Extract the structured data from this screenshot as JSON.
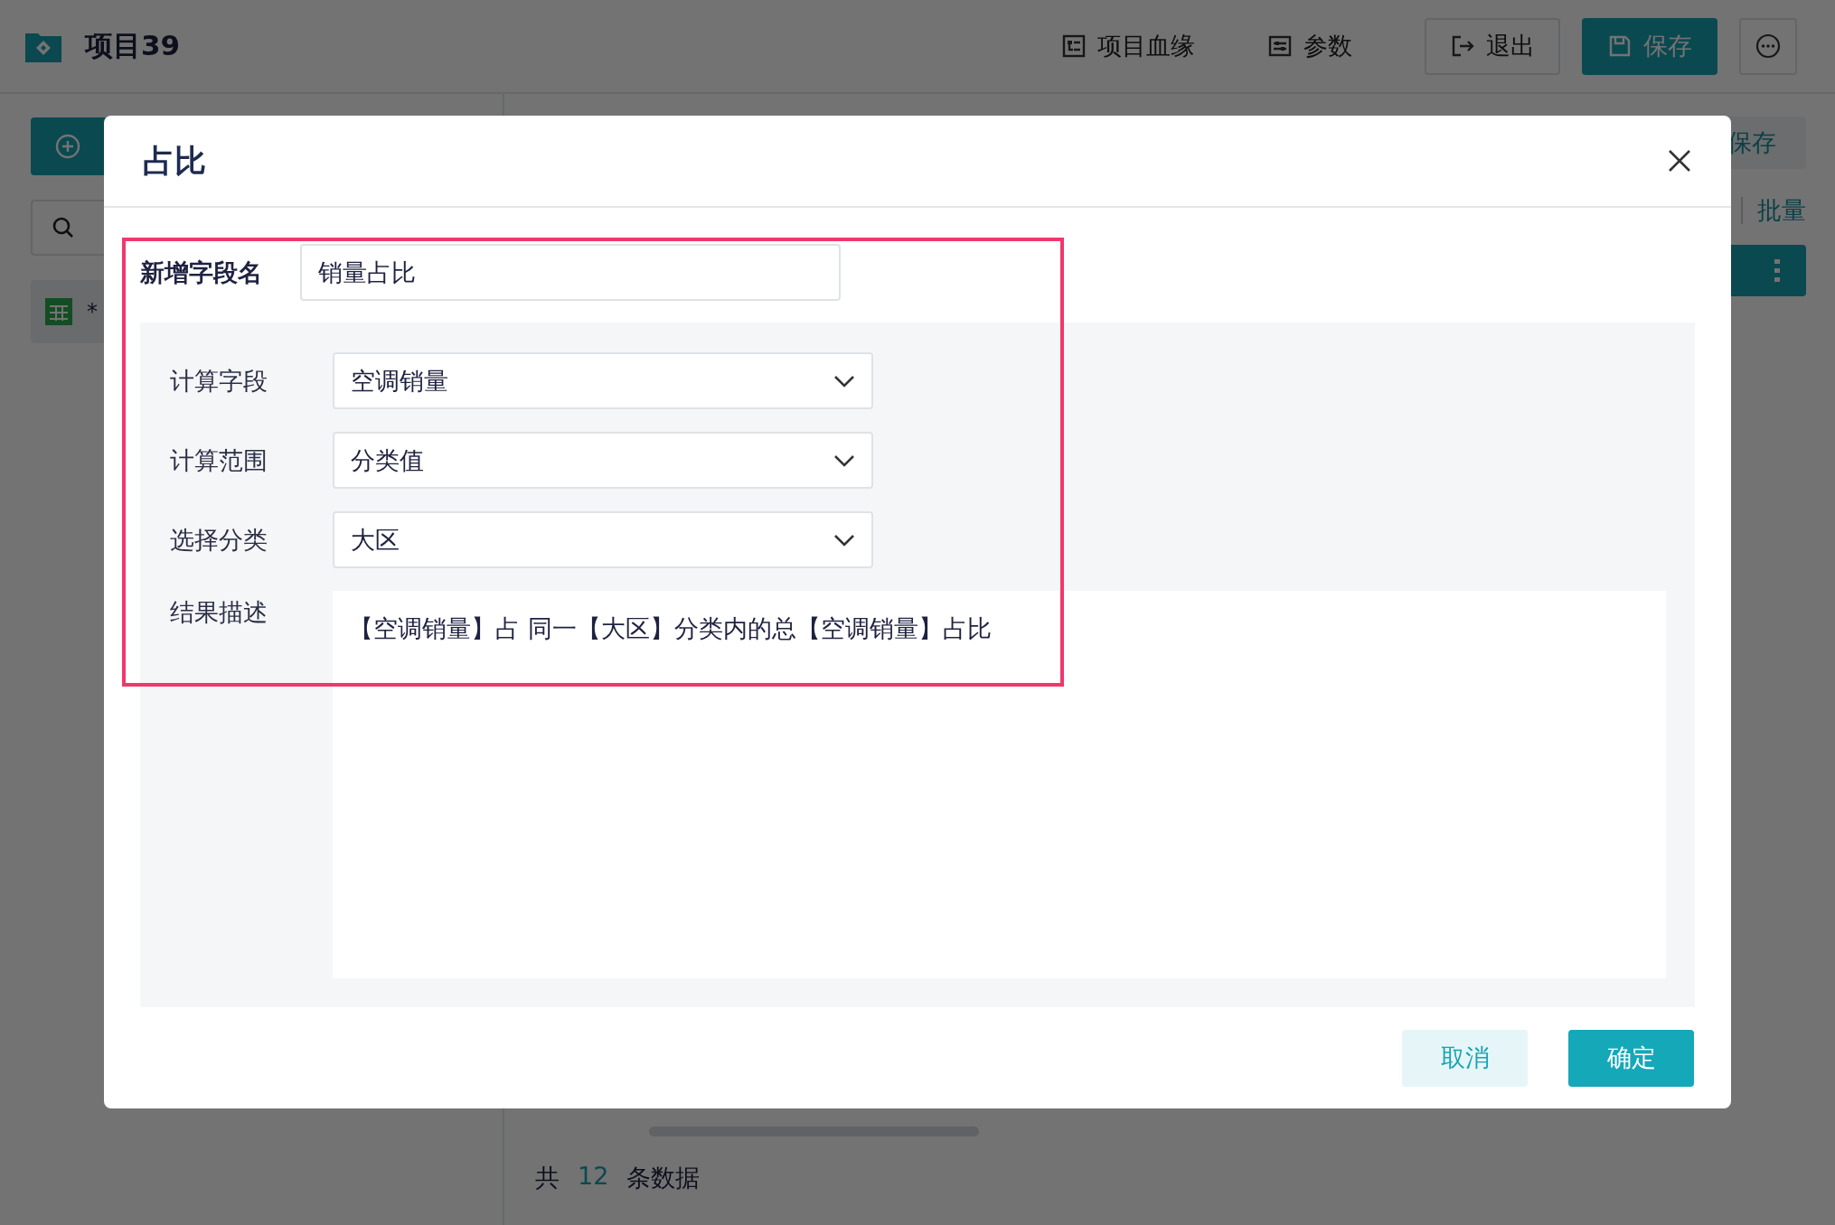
{
  "header": {
    "title": "项目39",
    "actions": [
      {
        "label": "项目血缘",
        "kind": "link"
      },
      {
        "label": "参数",
        "kind": "link"
      },
      {
        "label": "退出",
        "kind": "button"
      },
      {
        "label": "保存",
        "kind": "primary"
      }
    ]
  },
  "sidebar": {
    "items": [
      {
        "label": "*"
      }
    ]
  },
  "main": {
    "save_button": "保存",
    "toolbar": [
      "批量"
    ],
    "footer": {
      "prefix": "共",
      "count": "12",
      "suffix": "条数据"
    }
  },
  "dialog": {
    "title": "占比",
    "name_field": {
      "label": "新增字段名",
      "value": "销量占比"
    },
    "selects": [
      {
        "label": "计算字段",
        "value": "空调销量"
      },
      {
        "label": "计算范围",
        "value": "分类值"
      },
      {
        "label": "选择分类",
        "value": "大区"
      }
    ],
    "result": {
      "label": "结果描述",
      "text": "【空调销量】占 同一【大区】分类内的总【空调销量】占比"
    },
    "buttons": [
      {
        "label": "取消",
        "kind": "secondary"
      },
      {
        "label": "确定",
        "kind": "primary"
      }
    ]
  }
}
